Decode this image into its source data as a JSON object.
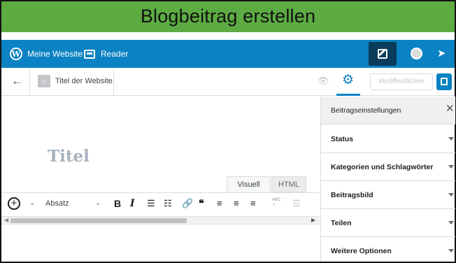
{
  "banner": {
    "title": "Blogbeitrag erstellen"
  },
  "masterbar": {
    "site_label": "Meine Website",
    "reader_label": "Reader",
    "wp_logo_icon": "wordpress-logo-icon",
    "write_icon": "write-post-icon",
    "avatar_icon": "user-avatar-icon",
    "notifications_icon": "notifications-icon",
    "background_color": "#0a82c3"
  },
  "editor_header": {
    "back_icon": "←",
    "site_title": "Titel der Website",
    "preview_icon": "eye-icon",
    "settings_icon": "gear-icon",
    "publish_label": "Veröffentlichen",
    "schedule_icon": "calendar-icon",
    "accent_color": "#0a82c3"
  },
  "editor": {
    "title_placeholder": "Titel",
    "tabs": [
      {
        "label": "Visuell",
        "active": true
      },
      {
        "label": "HTML",
        "active": false
      }
    ],
    "toolbar": {
      "add_block": "+",
      "format_select": "Absatz",
      "chevron": "⌄",
      "bold": "B",
      "italic": "I",
      "bullet_list": "☰",
      "numbered_list": "☷",
      "link": "🔗",
      "blockquote": "❝",
      "align_left": "≡",
      "align_center": "≡",
      "align_right": "≡",
      "spellcheck": "ABC",
      "kitchen_sink": "☲"
    }
  },
  "sidebar": {
    "title": "Beitragseinstellungen",
    "close_icon": "✕",
    "panels": [
      {
        "label": "Status"
      },
      {
        "label": "Kategorien und Schlagwörter"
      },
      {
        "label": "Beitragsbild"
      },
      {
        "label": "Teilen"
      },
      {
        "label": "Weitere Optionen"
      }
    ]
  }
}
